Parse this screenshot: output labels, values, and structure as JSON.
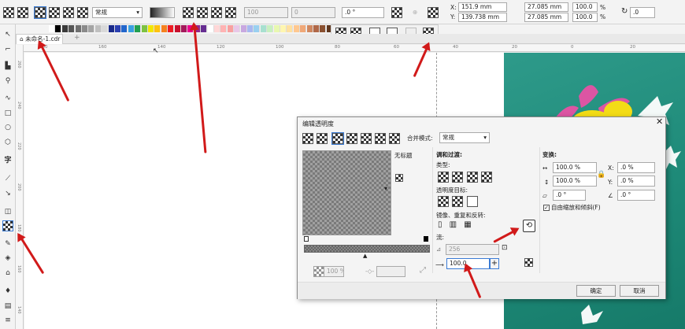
{
  "propbar": {
    "merge_mode": "常规",
    "opacity": "100",
    "fade": "0",
    "angle": ".0 °",
    "x": "151.9 mm",
    "y": "139.738 mm",
    "width": "27.085 mm",
    "height": "27.085 mm",
    "scale_w": "100.0",
    "scale_h": "100.0",
    "pct": "%",
    "rotation": ".0"
  },
  "palette": [
    "#ffffff",
    "#000000",
    "#3a3a3a",
    "#555555",
    "#6f6f6f",
    "#8a8a8a",
    "#a4a4a4",
    "#bfbfbf",
    "#d9d9d9",
    "#1a2a8a",
    "#2b3fb0",
    "#2266cc",
    "#3aa0e0",
    "#22a050",
    "#7dc242",
    "#f2e600",
    "#ffc20e",
    "#f58220",
    "#ed1c24",
    "#c8102e",
    "#a3195b",
    "#ec008c",
    "#92278f",
    "#662d91",
    "#ffffff",
    "#ffd7d7",
    "#ffb3b3",
    "#f8a0a0",
    "#e8c8e8",
    "#c8a8e0",
    "#a8b8f0",
    "#9ad0f0",
    "#a8e0d0",
    "#c8f0c0",
    "#e8f8b0",
    "#fff6b0",
    "#ffe0a0",
    "#ffc890",
    "#f0a878",
    "#d08860",
    "#b06848",
    "#8a5030",
    "#603820",
    "#402010"
  ],
  "tabs": {
    "doc_name": "未命名-1.cdr"
  },
  "ruler_h_marks": [
    "180",
    "160",
    "140",
    "120",
    "100",
    "80",
    "60",
    "40",
    "20",
    "0",
    "20"
  ],
  "ruler_v_marks": [
    "260",
    "240",
    "220",
    "200",
    "180",
    "160",
    "140"
  ],
  "dialog": {
    "title": "编辑透明度",
    "merge_label": "合并模式:",
    "merge_value": "常规",
    "no_title": "无标题",
    "mix_label": "调和过渡:",
    "type_label": "类型:",
    "target_label": "透明度目标:",
    "mirror_label": "镜像、重复和反转:",
    "flow_label": "流:",
    "flow_value": "256",
    "accel_value": "100.0",
    "left_pct": "100 %",
    "left_sub": "",
    "transform_label": "变换:",
    "w_pct": "100.0 %",
    "h_pct": "100.0 %",
    "x_label": "X:",
    "x_pct": ".0 %",
    "y_label": "Y:",
    "y_pct": ".0 %",
    "skew": ".0 °",
    "rotate": ".0 °",
    "free_scale_label": "自由缩放和倾斜(F)",
    "ok": "确定",
    "cancel": "取消"
  }
}
